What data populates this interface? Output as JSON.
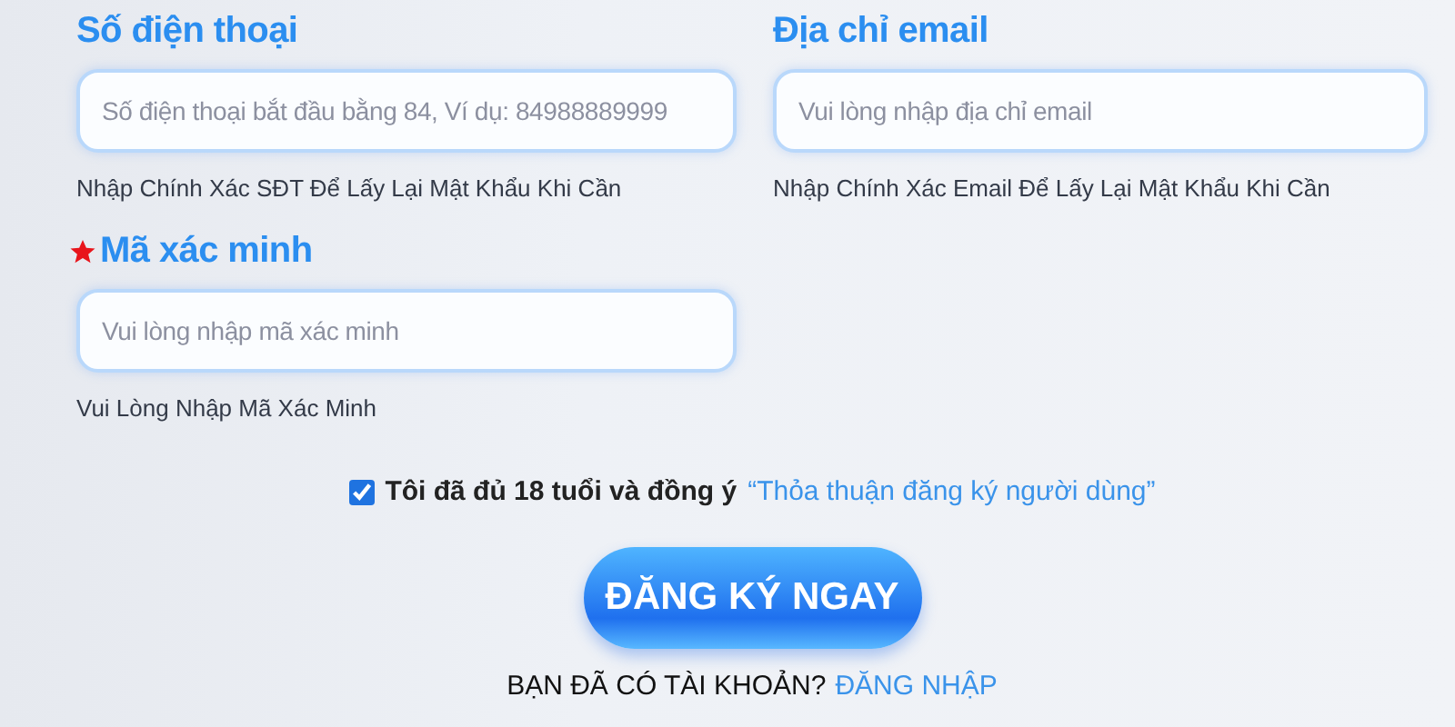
{
  "fields": [
    {
      "label": "Số điện thoại",
      "placeholder": "Số điện thoại bắt đầu bằng 84, Ví dụ: 84988889999",
      "hint": "Nhập Chính Xác SĐT Để Lấy Lại Mật Khẩu Khi Cần",
      "required": false
    },
    {
      "label": "Địa chỉ email",
      "placeholder": "Vui lòng nhập địa chỉ email",
      "hint": "Nhập Chính Xác Email Để Lấy Lại Mật Khẩu Khi Cần",
      "required": false
    },
    {
      "label": "Mã xác minh",
      "placeholder": "Vui lòng nhập mã xác minh",
      "hint": "Vui Lòng Nhập Mã Xác Minh",
      "required": true
    }
  ],
  "agreement": {
    "checked": true,
    "text": "Tôi đã đủ 18 tuổi và đồng ý",
    "link": "“Thỏa thuận đăng ký người dùng”"
  },
  "submit": "ĐĂNG KÝ NGAY",
  "login": {
    "prompt": "BẠN ĐÃ CÓ TÀI KHOẢN?",
    "link": "ĐĂNG NHẬP"
  }
}
